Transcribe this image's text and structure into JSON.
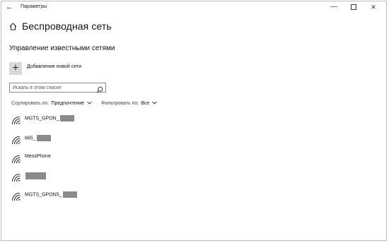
{
  "window": {
    "title": "Параметры",
    "back_glyph": "←",
    "min_glyph": "—",
    "close_glyph": "✕"
  },
  "header": {
    "title": "Беспроводная сеть",
    "icon": "home-icon"
  },
  "section": {
    "title": "Управление известными сетями"
  },
  "add_network": {
    "label": "Добавление новой сети",
    "icon_glyph": "+"
  },
  "search": {
    "placeholder": "Искать в этом списке",
    "value": ""
  },
  "sort": {
    "label": "Сортировать по:",
    "value": "Предпочтение"
  },
  "filter": {
    "label": "Фильтровать по:",
    "value": "Все"
  },
  "networks": [
    {
      "name": "MGTS_GPON_",
      "redacted": true
    },
    {
      "name": "665_",
      "redacted": true
    },
    {
      "name": "MessPhone",
      "redacted": false
    },
    {
      "name": "",
      "redacted": true
    },
    {
      "name": "MGTS_GPON5_",
      "redacted": true
    }
  ],
  "colors": {
    "redaction": "#8a8a8a",
    "add_button_bg": "#d9d9d9"
  }
}
